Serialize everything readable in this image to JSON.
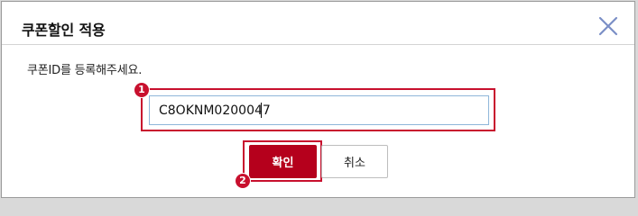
{
  "dialog": {
    "title": "쿠폰할인 적용",
    "instruction": "쿠폰ID를 등록해주세요.",
    "coupon_input": {
      "value": "C8OKNM0200047"
    },
    "buttons": {
      "confirm_label": "확인",
      "cancel_label": "취소"
    },
    "step_badges": {
      "first": "1",
      "second": "2"
    }
  },
  "colors": {
    "highlight": "#c8102e",
    "confirm_button": "#b5001c",
    "close_icon": "#7b8fc6",
    "input_border": "#8fb6d9"
  },
  "icons": {
    "close": "close-icon"
  }
}
